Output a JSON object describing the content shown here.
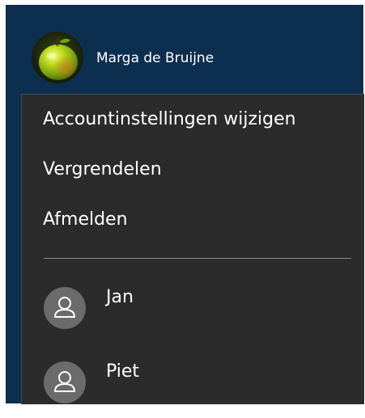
{
  "current_user": {
    "name": "Marga de Bruijne",
    "avatar_icon": "apple-avatar-icon"
  },
  "menu": {
    "items": [
      {
        "label": "Accountinstellingen wijzigen"
      },
      {
        "label": "Vergrendelen"
      },
      {
        "label": "Afmelden"
      }
    ]
  },
  "other_accounts": [
    {
      "name": "Jan",
      "avatar_icon": "person-icon"
    },
    {
      "name": "Piet",
      "avatar_icon": "person-icon"
    }
  ],
  "colors": {
    "header_background": "#0d2f4f",
    "menu_background": "#2b2b2b",
    "text": "#ffffff",
    "generic_avatar": "#6b6b6b"
  }
}
